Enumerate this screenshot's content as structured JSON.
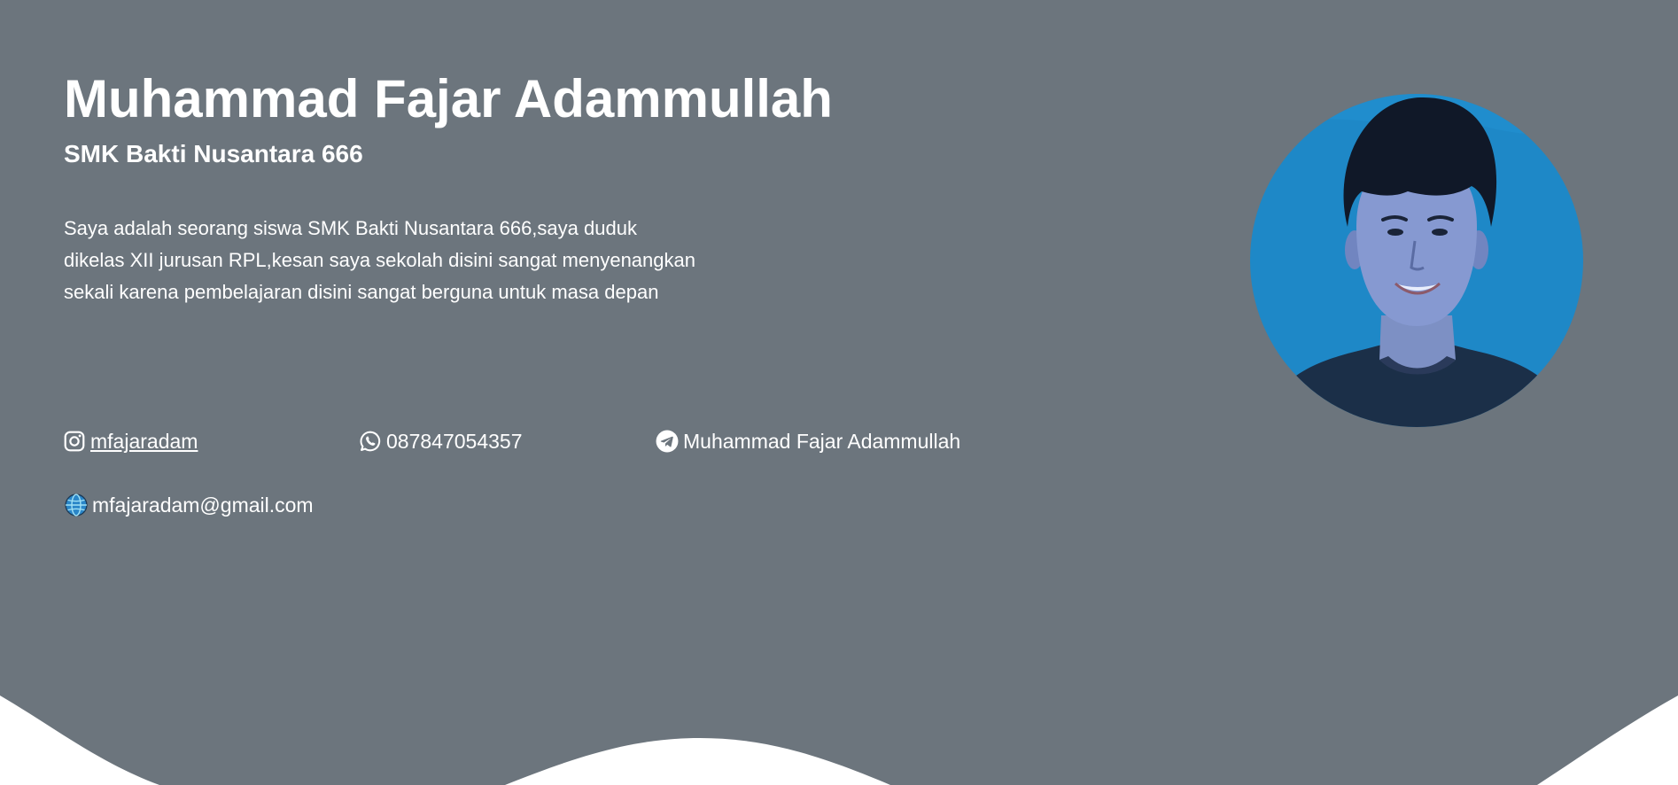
{
  "profile": {
    "name": "Muhammad Fajar Adammullah",
    "school": "SMK Bakti Nusantara 666",
    "bio": "Saya adalah seorang siswa SMK Bakti Nusantara 666,saya duduk dikelas XII jurusan RPL,kesan saya sekolah disini sangat menyenangkan sekali karena pembelajaran disini sangat berguna untuk masa depan"
  },
  "contacts": {
    "instagram": {
      "icon": "instagram-icon",
      "label": "mfajaradam"
    },
    "whatsapp": {
      "icon": "whatsapp-icon",
      "label": "087847054357"
    },
    "telegram": {
      "icon": "telegram-icon",
      "label": "Muhammad Fajar Adammullah"
    },
    "email": {
      "icon": "globe-icon",
      "label": "mfajaradam@gmail.com"
    }
  },
  "colors": {
    "hero_background": "#6c757d",
    "page_background": "#ffffff",
    "text": "#ffffff",
    "photo_background": "#1e88c7"
  }
}
